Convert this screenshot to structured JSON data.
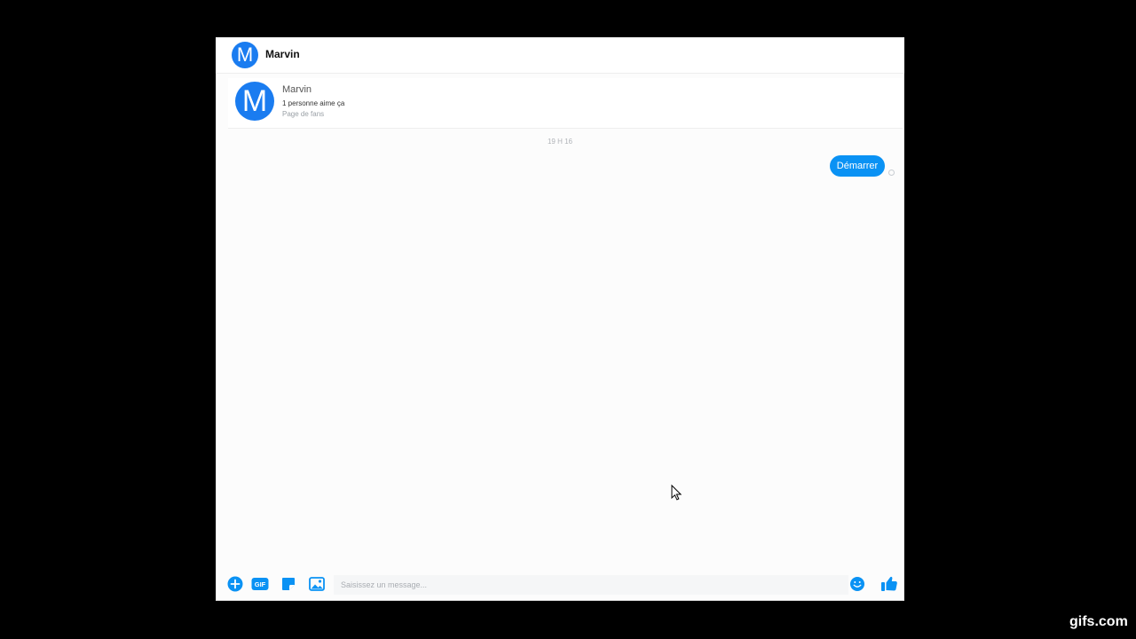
{
  "header": {
    "avatar_letter": "M",
    "name": "Marvin"
  },
  "page_card": {
    "avatar_letter": "M",
    "name": "Marvin",
    "likes": "1 personne aime ça",
    "category": "Page de fans"
  },
  "conversation": {
    "timestamp": "19 H 16",
    "messages": [
      {
        "text": "Démarrer",
        "from": "self"
      }
    ]
  },
  "composer": {
    "placeholder": "Saisissez un message...",
    "tools": [
      "plus-icon",
      "gif-icon",
      "sticker-icon",
      "image-icon"
    ],
    "gif_label": "GIF"
  },
  "colors": {
    "accent": "#0a92f4",
    "avatar": "#1a7cf0",
    "background": "#000000"
  },
  "watermark": "gifs.com"
}
